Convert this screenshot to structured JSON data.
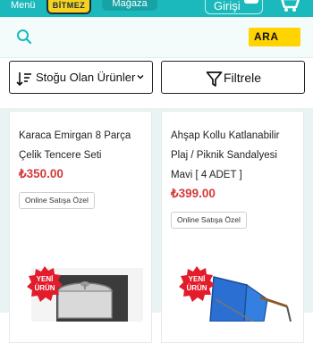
{
  "header": {
    "menu_label": "Menü",
    "logo_text": "BİTMEZ",
    "store_label": "Mağaza",
    "login_label": "Girişi",
    "icons": [
      "user-icon",
      "cart-icon"
    ],
    "colors": {
      "bar": "#1bb9bb",
      "logo": "#f4d21f"
    }
  },
  "search": {
    "placeholder": "",
    "button_label": "ARA",
    "icon": "search-icon",
    "button_color": "#ffd400"
  },
  "filters": {
    "sort_label": "Stoğu Olan Ürünler",
    "filter_label": "Filtrele",
    "icons": [
      "sort-icon",
      "chevron-down-icon",
      "funnel-icon"
    ]
  },
  "products": [
    {
      "title_line1": "Karaca Emirgan 8 Parça",
      "title_line2": "Çelik Tencere Seti",
      "price": "₺350.00",
      "badge": "Online Satışa Özel",
      "new_tag": "YENİ ÜRÜN"
    },
    {
      "title_line1": "Ahşap Kollu Katlanabilir",
      "title_line2": "Plaj / Piknik Sandalyesi",
      "title_line3": "Mavi [ 4 ADET ]",
      "price": "₺399.00",
      "badge": "Online Satışa Özel",
      "new_tag": "YENİ ÜRÜN"
    }
  ],
  "colors": {
    "price": "#d53a3a",
    "grid_bg": "#eaf3f3"
  }
}
